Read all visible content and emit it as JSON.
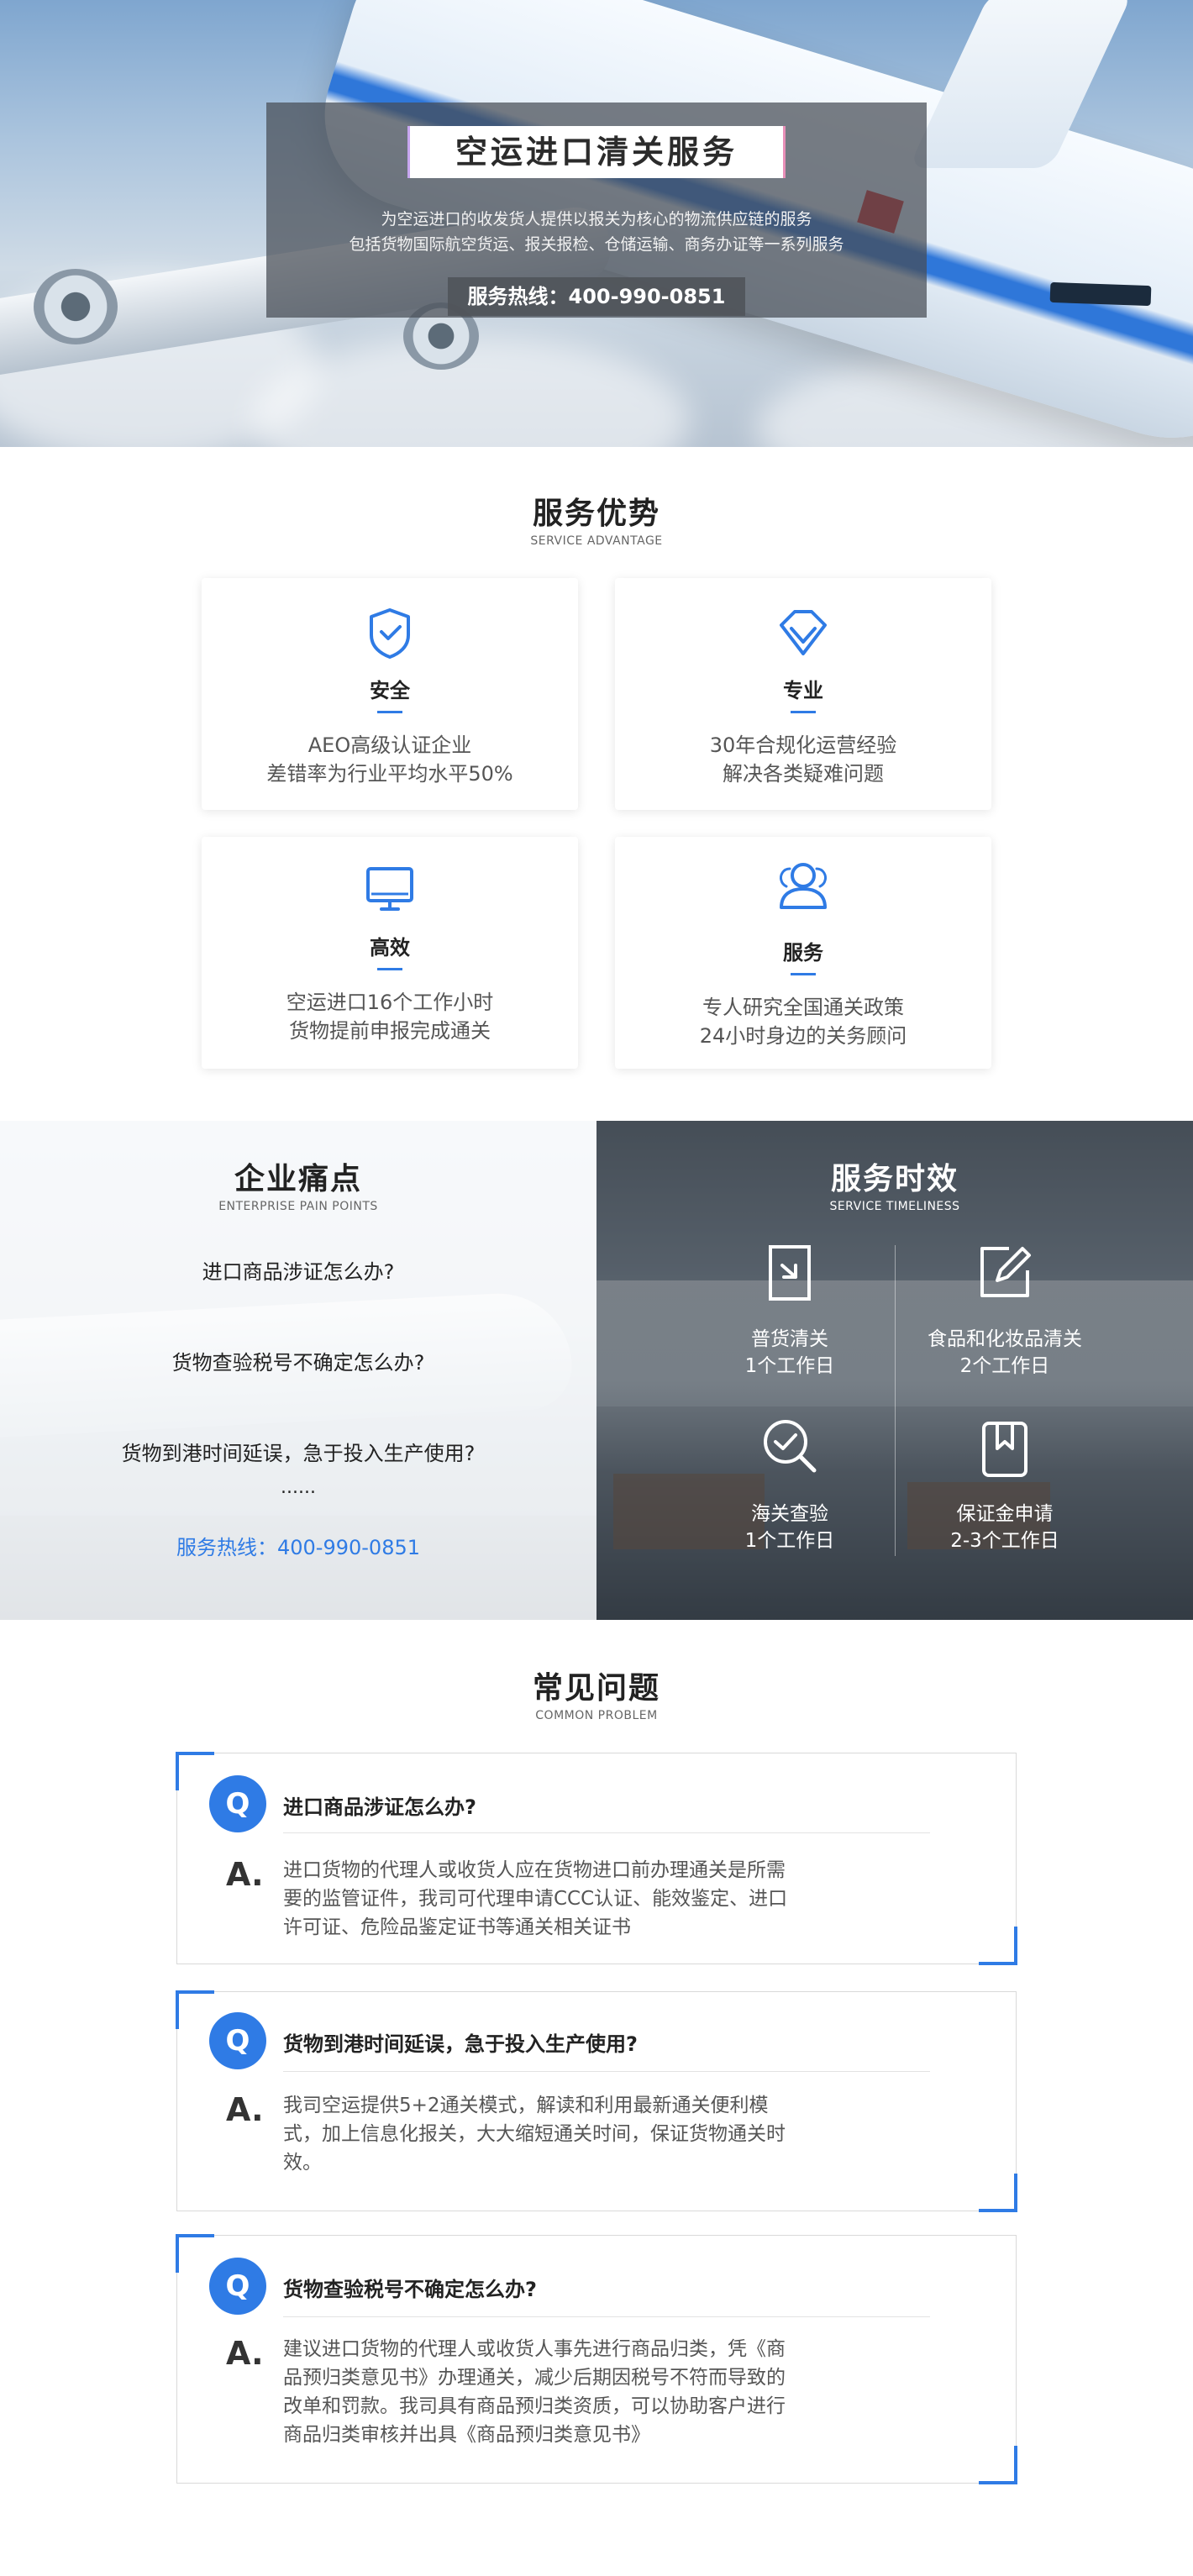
{
  "hero": {
    "title": "空运进口清关服务",
    "desc_line1": "为空运进口的收发货人提供以报关为核心的物流供应链的服务",
    "desc_line2": "包括货物国际航空货运、报关报检、仓储运输、商务办证等一系列服务",
    "hotline": "服务热线：400-990-0851"
  },
  "advantage": {
    "title": "服务优势",
    "subtitle": "SERVICE ADVANTAGE",
    "cards": [
      {
        "icon": "shield-check-icon",
        "title": "安全",
        "line1": "AEO高级认证企业",
        "line2": "差错率为行业平均水平50%"
      },
      {
        "icon": "diamond-icon",
        "title": "专业",
        "line1": "30年合规化运营经验",
        "line2": "解决各类疑难问题"
      },
      {
        "icon": "monitor-icon",
        "title": "高效",
        "line1": "空运进口16个工作小时",
        "line2": "货物提前申报完成通关"
      },
      {
        "icon": "users-icon",
        "title": "服务",
        "line1": "专人研究全国通关政策",
        "line2": "24小时身边的关务顾问"
      }
    ]
  },
  "pain": {
    "title": "企业痛点",
    "subtitle": "ENTERPRISE PAIN POINTS",
    "q1": "进口商品涉证怎么办?",
    "q2": "货物查验税号不确定怎么办?",
    "q3": "货物到港时间延误，急于投入生产使用?",
    "more": "......",
    "hotline": "服务热线：400-990-0851"
  },
  "timeliness": {
    "title": "服务时效",
    "subtitle": "SERVICE TIMELINESS",
    "items": [
      {
        "icon": "document-arrow-icon",
        "name": "普货清关",
        "time": "1个工作日"
      },
      {
        "icon": "edit-icon",
        "name": "食品和化妆品清关",
        "time": "2个工作日"
      },
      {
        "icon": "search-check-icon",
        "name": "海关查验",
        "time": "1个工作日"
      },
      {
        "icon": "bookmark-icon",
        "name": "保证金申请",
        "time": "2-3个工作日"
      }
    ]
  },
  "faq": {
    "title": "常见问题",
    "subtitle": "COMMON PROBLEM",
    "q_badge": "Q",
    "a_badge": "A.",
    "items": [
      {
        "q": "进口商品涉证怎么办?",
        "a1": "进口货物的代理人或收货人应在货物进口前办理通关是所需",
        "a2": "要的监管证件，我司可代理申请CCC认证、能效鉴定、进口",
        "a3": "许可证、危险品鉴定证书等通关相关证书",
        "a4": ""
      },
      {
        "q": "货物到港时间延误，急于投入生产使用?",
        "a1": "我司空运提供5+2通关模式，解读和利用最新通关便利模",
        "a2": "式，加上信息化报关，大大缩短通关时间，保证货物通关时",
        "a3": "效。",
        "a4": ""
      },
      {
        "q": "货物查验税号不确定怎么办?",
        "a1": "建议进口货物的代理人或收货人事先进行商品归类，凭《商",
        "a2": "品预归类意见书》办理通关，减少后期因税号不符而导致的",
        "a3": "改单和罚款。我司具有商品预归类资质，可以协助客户进行",
        "a4": "商品归类审核并出具《商品预归类意见书》"
      }
    ]
  },
  "colors": {
    "accent": "#2f7be5"
  }
}
